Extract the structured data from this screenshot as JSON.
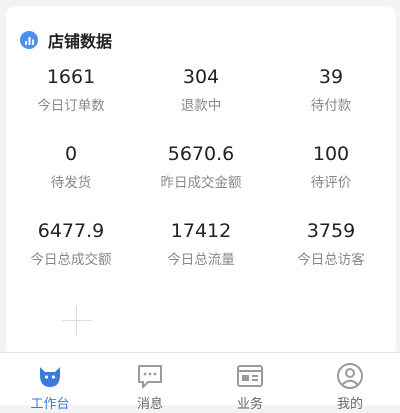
{
  "card": {
    "title": "店铺数据",
    "stats": [
      {
        "value": "1661",
        "label": "今日订单数"
      },
      {
        "value": "304",
        "label": "退款中"
      },
      {
        "value": "39",
        "label": "待付款"
      },
      {
        "value": "0",
        "label": "待发货"
      },
      {
        "value": "5670.6",
        "label": "昨日成交金额"
      },
      {
        "value": "100",
        "label": "待评价"
      },
      {
        "value": "6477.9",
        "label": "今日总成交额"
      },
      {
        "value": "17412",
        "label": "今日总流量"
      },
      {
        "value": "3759",
        "label": "今日总访客"
      }
    ]
  },
  "tabbar": {
    "tabs": [
      {
        "label": "工作台",
        "icon": "workbench-icon",
        "active": true
      },
      {
        "label": "消息",
        "icon": "message-icon",
        "active": false
      },
      {
        "label": "业务",
        "icon": "business-icon",
        "active": false
      },
      {
        "label": "我的",
        "icon": "profile-icon",
        "active": false
      }
    ]
  },
  "colors": {
    "accent": "#3a7bdc",
    "header_icon": "#4b8ff0",
    "label_gray": "#888888",
    "tab_icon_gray": "#9a9a9a"
  }
}
